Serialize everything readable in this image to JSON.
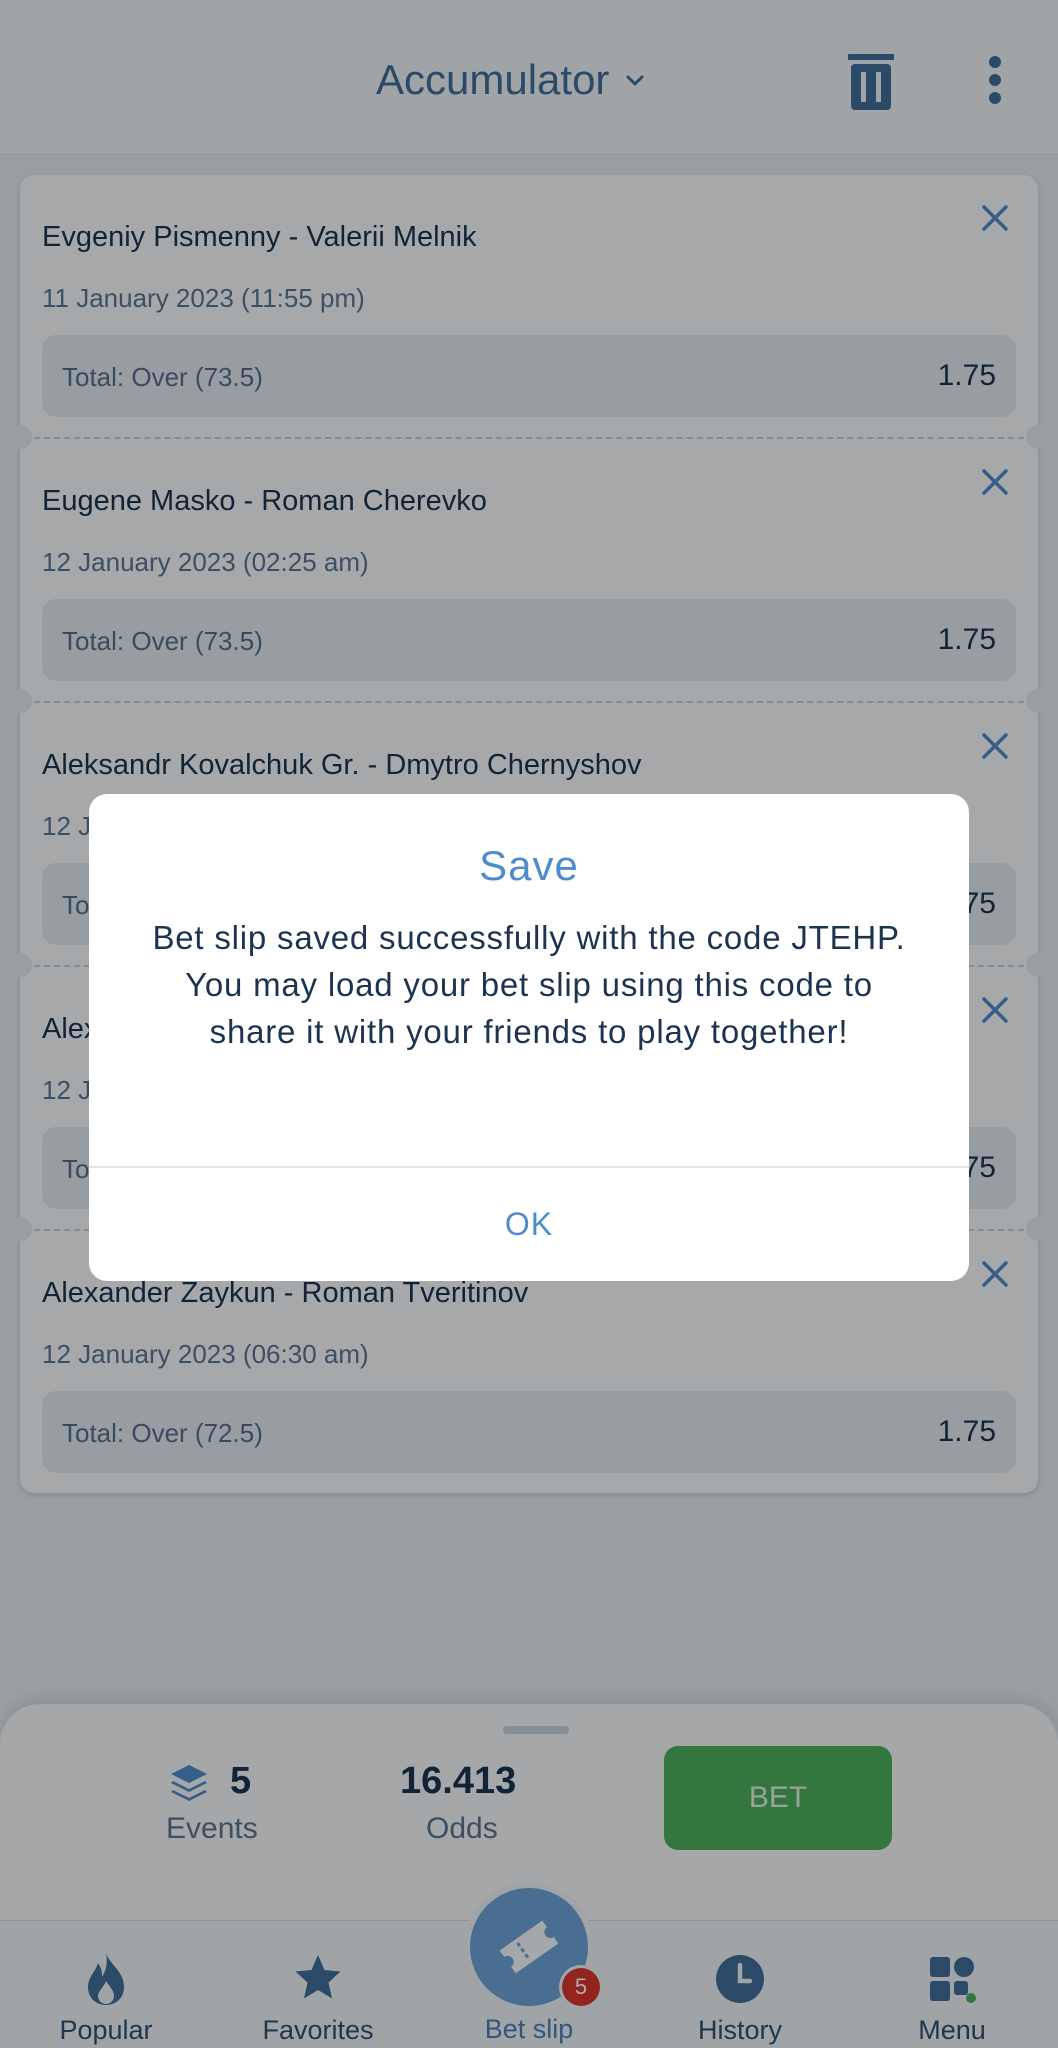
{
  "header": {
    "title": "Accumulator"
  },
  "events": [
    {
      "teams": "Evgeniy Pismenny - Valerii Melnik",
      "date": "11 January 2023 (11:55 pm)",
      "market": "Total: Over (73.5)",
      "odds": "1.75"
    },
    {
      "teams": "Eugene Masko - Roman Cherevko",
      "date": "12 January 2023 (02:25 am)",
      "market": "Total: Over (73.5)",
      "odds": "1.75"
    },
    {
      "teams": "Aleksandr Kovalchuk Gr. - Dmytro Chernyshov",
      "date": "12 Ja",
      "market": "To",
      "odds": "75"
    },
    {
      "teams": "Alex",
      "date": "12 J",
      "market": "To",
      "odds": "75"
    },
    {
      "teams": "Alexander Zaykun - Roman Tveritinov",
      "date": "12 January 2023 (06:30 am)",
      "market": "Total: Over (72.5)",
      "odds": "1.75"
    }
  ],
  "summary": {
    "events_count": "5",
    "events_label": "Events",
    "odds_value": "16.413",
    "odds_label": "Odds",
    "bet_label": "BET"
  },
  "nav": {
    "items": [
      {
        "label": "Popular",
        "icon": "flame-icon"
      },
      {
        "label": "Favorites",
        "icon": "star-icon"
      },
      {
        "label": "Bet slip",
        "icon": "ticket-icon"
      },
      {
        "label": "History",
        "icon": "clock-icon"
      },
      {
        "label": "Menu",
        "icon": "grid-icon"
      }
    ],
    "betslip_badge": "5"
  },
  "dialog": {
    "title": "Save",
    "message": "Bet slip saved successfully with the code JTEHP. You may load your bet slip using this code to share it with your friends to play together!",
    "ok_label": "OK"
  },
  "colors": {
    "accent": "#4f8cc9",
    "bet_button": "#4cae5c",
    "badge": "#d9342b"
  }
}
